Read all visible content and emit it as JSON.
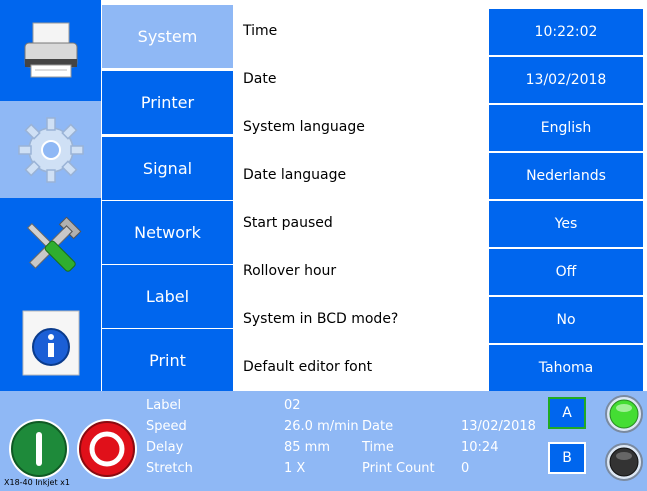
{
  "menu": {
    "items": [
      {
        "label": "System",
        "active": true
      },
      {
        "label": "Printer",
        "active": false
      },
      {
        "label": "Signal",
        "active": false
      },
      {
        "label": "Network",
        "active": false
      },
      {
        "label": "Label",
        "active": false
      },
      {
        "label": "Print",
        "active": false
      }
    ]
  },
  "icons": [
    "printer-icon",
    "settings-gear-icon",
    "tools-icon",
    "info-icon"
  ],
  "settings": [
    {
      "label": "Time",
      "value": "10:22:02"
    },
    {
      "label": "Date",
      "value": "13/02/2018"
    },
    {
      "label": "System language",
      "value": "English"
    },
    {
      "label": "Date language",
      "value": "Nederlands"
    },
    {
      "label": "Start paused",
      "value": "Yes"
    },
    {
      "label": "Rollover hour",
      "value": "Off"
    },
    {
      "label": "System in BCD mode?",
      "value": "No"
    },
    {
      "label": "Default editor font",
      "value": "Tahoma"
    }
  ],
  "status": {
    "label_key": "Label",
    "label_val": "02",
    "speed_key": "Speed",
    "speed_val": "26.0 m/min",
    "delay_key": "Delay",
    "delay_val": "85 mm",
    "stretch_key": "Stretch",
    "stretch_val": "1 X",
    "date_key": "Date",
    "date_val": "13/02/2018",
    "time_key": "Time",
    "time_val": "10:24",
    "count_key": "Print Count",
    "count_val": "0",
    "btn_a": "A",
    "btn_b": "B",
    "led_a_color": "#44dd33",
    "led_b_color": "#333333"
  },
  "footer": "X18-40 Inkjet x1",
  "colors": {
    "accent": "#0066ee",
    "light": "#8fb8f5",
    "start": "#1e8a3a",
    "stop": "#e0101a"
  }
}
